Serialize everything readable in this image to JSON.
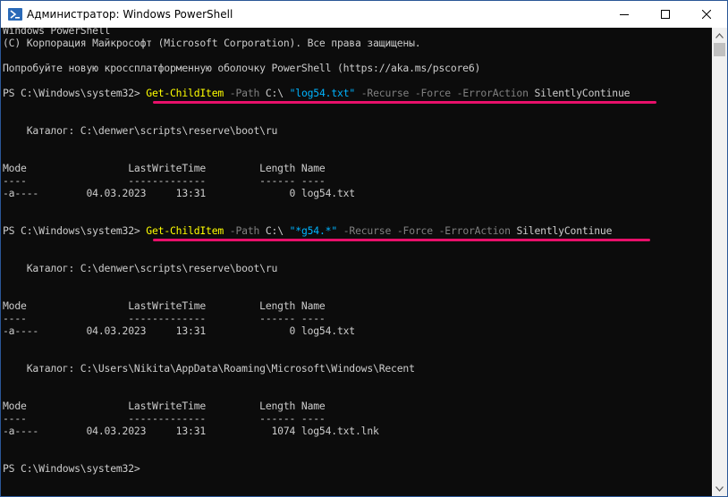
{
  "window": {
    "title": "Администратор: Windows PowerShell",
    "icon": "powershell-icon"
  },
  "titlebar_buttons": [
    "minimize-icon",
    "maximize-icon",
    "close-icon"
  ],
  "console": {
    "header1": "Windows PowerShell",
    "header2": "(C) Корпорация Майкрософт (Microsoft Corporation). Все права защищены.",
    "header3": "Попробуйте новую кроссплатформенную оболочку PowerShell (https://aka.ms/pscore6)",
    "prompt": "PS C:\\Windows\\system32>",
    "cmd1": {
      "cmdlet": "Get-ChildItem",
      "p1": "-Path",
      "v1": "C:\\",
      "v2": "\"log54.txt\"",
      "p2": "-Recurse",
      "p3": "-Force",
      "p4": "-ErrorAction",
      "v3": "SilentlyContinue"
    },
    "cmd2": {
      "cmdlet": "Get-ChildItem",
      "p1": "-Path",
      "v1": "C:\\",
      "v2": "\"*g54.*\"",
      "p2": "-Recurse",
      "p3": "-Force",
      "p4": "-ErrorAction",
      "v3": "SilentlyContinue"
    },
    "dir1": "    Каталог: C:\\denwer\\scripts\\reserve\\boot\\ru",
    "dir2": "    Каталог: C:\\Users\\Nikita\\AppData\\Roaming\\Microsoft\\Windows\\Recent",
    "table_header": "Mode                 LastWriteTime         Length Name",
    "table_sep": "----                 -------------         ------ ----",
    "row1": "-a----        04.03.2023     13:31              0 log54.txt",
    "row2": "-a----        04.03.2023     13:31              0 log54.txt",
    "row3": "-a----        04.03.2023     13:31           1074 log54.txt.lnk"
  },
  "colors": {
    "background": "#0c0c0c",
    "text": "#cccccc",
    "cmdlet": "#ffff00",
    "string": "#00b4ff",
    "operator": "#808080",
    "highlight": "#e8106a"
  }
}
